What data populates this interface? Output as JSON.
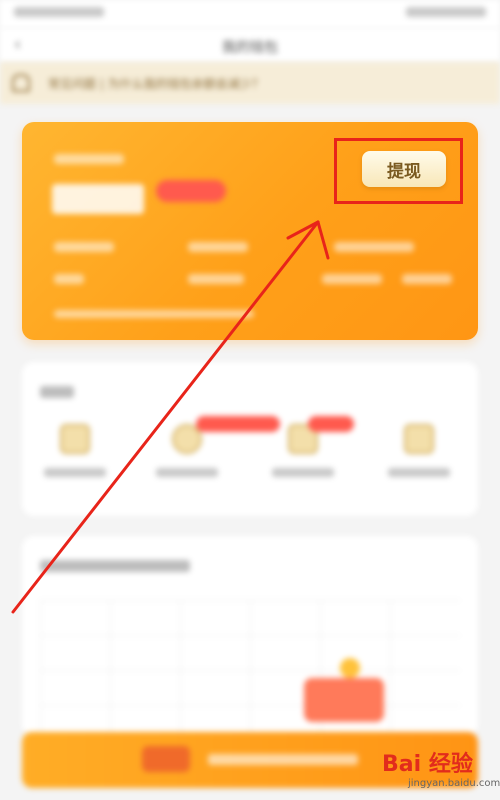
{
  "header": {
    "title": "我的钱包",
    "back_icon": "chevron-left-icon"
  },
  "notice": {
    "text": "常见问题 | 为什么我的钱包余额会减少？"
  },
  "wallet_card": {
    "withdraw_label": "提现"
  },
  "annotation": {
    "box_color": "#e8241a",
    "arrow_color": "#e8241a"
  },
  "watermark": {
    "brand": "Bai 经验",
    "site": "jingyan.baidu.com"
  },
  "colors": {
    "card_gradient_start": "#ffb631",
    "card_gradient_end": "#ff9614",
    "withdraw_text": "#7a5a20",
    "notice_bg": "#f6edd8"
  }
}
